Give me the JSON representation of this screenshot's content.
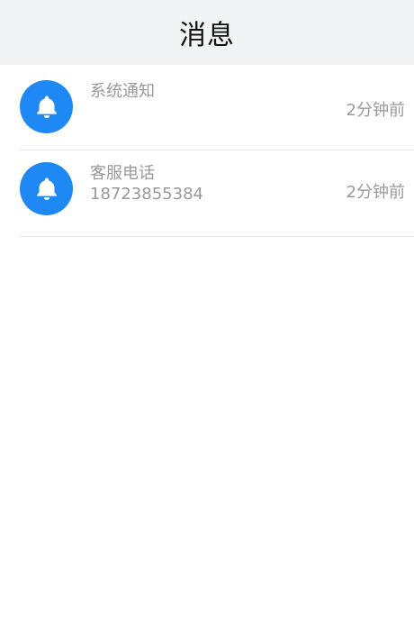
{
  "header": {
    "title": "消息"
  },
  "messages": [
    {
      "title": "系统通知",
      "subtitle": "",
      "time": "2分钟前",
      "icon": "bell-icon"
    },
    {
      "title": "客服电话",
      "subtitle": "18723855384",
      "time": "2分钟前",
      "icon": "bell-icon"
    }
  ],
  "colors": {
    "header_bg": "#f2f3f5",
    "icon_bg": "#1e88f5",
    "muted_text": "#999999"
  }
}
